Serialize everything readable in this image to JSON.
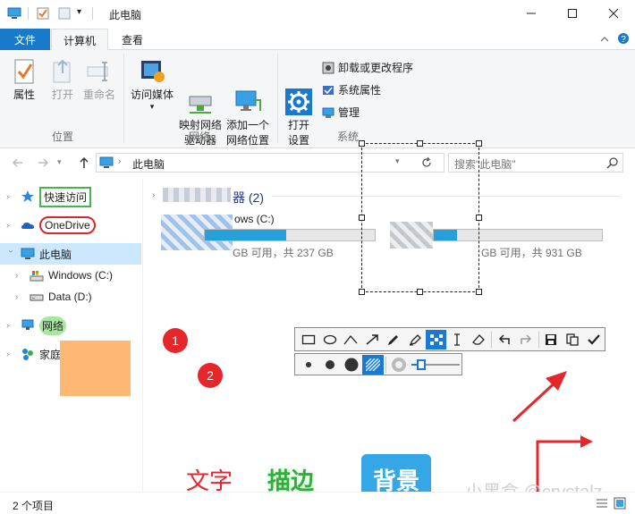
{
  "window": {
    "title": "此电脑",
    "quick_access_dropdown": "▾"
  },
  "ribbon": {
    "tabs": [
      {
        "label": "文件",
        "active": false
      },
      {
        "label": "计算机",
        "active": true
      },
      {
        "label": "查看",
        "active": false
      }
    ],
    "groups": [
      {
        "label": "位置",
        "buttons": [
          "属性",
          "打开",
          "重命名"
        ]
      },
      {
        "label": "网络",
        "buttons": [
          "访问媒体",
          "映射网络\n驱动器",
          "添加一个\n网络位置"
        ]
      },
      {
        "label": "系统",
        "buttons": [
          "打开\n设置"
        ],
        "small_buttons": [
          "卸载或更改程序",
          "系统属性",
          "管理"
        ]
      }
    ]
  },
  "address": {
    "path": "此电脑",
    "search_placeholder": "搜索\"此电脑\""
  },
  "sidebar": {
    "items": [
      {
        "label": "快速访问",
        "level": 0,
        "expanded": false
      },
      {
        "label": "OneDrive",
        "level": 0,
        "expanded": false
      },
      {
        "label": "此电脑",
        "level": 0,
        "expanded": true,
        "selected": true
      },
      {
        "label": "Windows (C:)",
        "level": 1,
        "expanded": false
      },
      {
        "label": "Data (D:)",
        "level": 1,
        "expanded": false
      },
      {
        "label": "网络",
        "level": 0,
        "expanded": false
      },
      {
        "label": "家庭组",
        "level": 0,
        "expanded": false
      }
    ]
  },
  "content": {
    "section_header_visible": "器 (2)",
    "drives": [
      {
        "label_visible": "ows (C:)",
        "free_text": "GB 可用，共 237 GB",
        "used_fraction": 0.48
      },
      {
        "label_visible": "",
        "free_text": "GB 可用，共 931 GB",
        "used_fraction": 0.14
      }
    ]
  },
  "status": {
    "item_count": "2 个项目"
  },
  "annotations": {
    "num1": "1",
    "num2": "2",
    "text_label": "文字",
    "stroke_label": "描边",
    "background_label": "背景",
    "watermark": "小黑盒 @crystalz"
  },
  "colors": {
    "accent_blue": "#1979ca",
    "progress_blue": "#26a0da",
    "annotation_red": "#e5262b",
    "stroke_green": "#2eae3b",
    "highlight_green": "#a9e6a4",
    "highlight_orange": "#ffb873",
    "background_label_bg": "#36a7e6"
  }
}
